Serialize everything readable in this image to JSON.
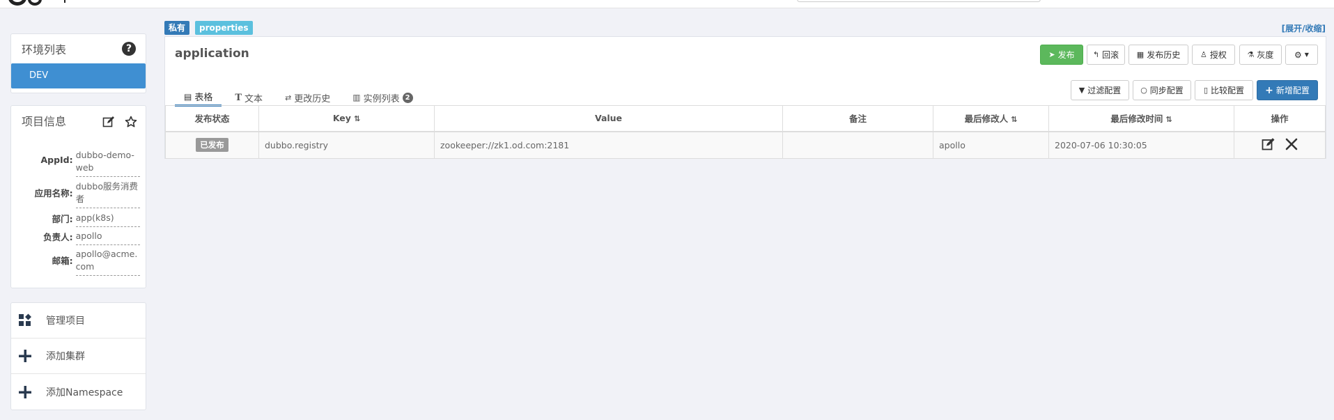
{
  "sidebar": {
    "env_panel": {
      "title": "环境列表",
      "help_icon": "?",
      "items": [
        {
          "label": "DEV"
        }
      ]
    },
    "info_panel": {
      "title": "项目信息",
      "fields": [
        {
          "label": "AppId:",
          "value": "dubbo-demo-web"
        },
        {
          "label": "应用名称:",
          "value": "dubbo服务消费者"
        },
        {
          "label": "部门:",
          "value": "app(k8s)"
        },
        {
          "label": "负责人:",
          "value": "apollo"
        },
        {
          "label": "邮箱:",
          "value": "apollo@acme.com"
        }
      ]
    },
    "menu": [
      {
        "label": "管理项目",
        "icon": "dashboard-icon"
      },
      {
        "label": "添加集群",
        "icon": "plus-icon"
      },
      {
        "label": "添加Namespace",
        "icon": "plus-icon"
      }
    ]
  },
  "namespace": {
    "tag_private": "私有",
    "tag_format": "properties",
    "expand_toggle": "[展开/收缩]",
    "title": "application",
    "actions": {
      "publish": "发布",
      "rollback": "回滚",
      "history": "发布历史",
      "authorize": "授权",
      "gray": "灰度"
    },
    "tabs": [
      {
        "label": "表格"
      },
      {
        "label": "文本"
      },
      {
        "label": "更改历史"
      },
      {
        "label": "实例列表",
        "badge": "2"
      }
    ],
    "toolbar": {
      "filter": "过滤配置",
      "sync": "同步配置",
      "compare": "比较配置",
      "add": "新增配置"
    },
    "table": {
      "headers": [
        "发布状态",
        "Key",
        "Value",
        "备注",
        "最后修改人",
        "最后修改时间",
        "操作"
      ],
      "rows": [
        {
          "status": "已发布",
          "key": "dubbo.registry",
          "value": "zookeeper://zk1.od.com:2181",
          "comment": "",
          "modifier": "apollo",
          "modified_time": "2020-07-06 10:30:05"
        }
      ]
    }
  },
  "colors": {
    "primary": "#337ab7",
    "success": "#5cb85c",
    "info": "#5bc0de",
    "env_active": "#3f8fd2"
  }
}
